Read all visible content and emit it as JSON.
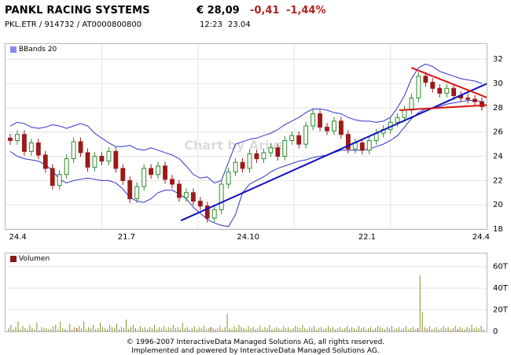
{
  "header": {
    "name": "PANKL RACING SYSTEMS",
    "price": "€ 28,09",
    "change": "-0,41",
    "change_pct": "-1,44%",
    "ids": "PKL.ETR  /  914732  /  AT0000800800",
    "time": "12:23",
    "date": "23.04"
  },
  "colors": {
    "accent_negative": "#b22222",
    "candle_up": "#2e8b2e",
    "candle_down": "#9b1a1a",
    "bollinger": "#3333cc",
    "trend_up": "#1010c0",
    "trend_red": "#dd1111",
    "volume": "#8b8b2b",
    "volume_highlight": "#8b1a1a",
    "grid": "#e4e4e4"
  },
  "watermark": "Chart by Ariva",
  "footer": {
    "line1": "© 1996-2007 InteractiveData Managed Solutions  AG, all rights reserved.",
    "line2": "Implemented and powered by  InteractiveData Managed Solutions  AG."
  },
  "chart_data": [
    {
      "type": "candlestick",
      "legend": "BBands 20",
      "x_ticks": [
        "24.4",
        "21.7",
        "24.10",
        "22.1",
        "24.4"
      ],
      "y_ticks": [
        18,
        20,
        22,
        24,
        26,
        28,
        30,
        32
      ],
      "ylim": [
        18,
        32.6
      ],
      "grid": true,
      "closes": [
        25.3,
        25.8,
        24.4,
        25.1,
        24.1,
        23.0,
        21.6,
        22.5,
        23.8,
        25.2,
        24.3,
        23.1,
        24.0,
        23.6,
        24.4,
        23.0,
        22.0,
        20.5,
        21.5,
        23.0,
        22.5,
        23.2,
        22.1,
        21.7,
        20.6,
        21.0,
        20.3,
        19.9,
        18.9,
        19.6,
        21.7,
        22.7,
        23.5,
        23.0,
        24.2,
        23.8,
        24.3,
        24.7,
        24.0,
        25.3,
        25.7,
        25.0,
        26.5,
        27.5,
        26.4,
        26.1,
        26.9,
        25.8,
        24.6,
        25.1,
        24.5,
        25.3,
        25.9,
        26.2,
        26.8,
        27.2,
        27.8,
        28.8,
        30.6,
        30.1,
        29.6,
        29.2,
        29.6,
        29.0,
        28.8,
        28.7,
        28.5,
        28.1
      ],
      "bband_upper": [
        26.5,
        26.8,
        26.7,
        26.4,
        26.3,
        26.4,
        26.6,
        26.5,
        26.3,
        26.5,
        26.7,
        26.5,
        25.9,
        25.5,
        25.1,
        24.8,
        24.8,
        24.9,
        24.6,
        24.5,
        24.7,
        24.5,
        24.3,
        24.1,
        23.8,
        23.2,
        22.5,
        22.2,
        22.3,
        21.8,
        22.0,
        23.5,
        25.0,
        25.2,
        25.4,
        25.5,
        25.7,
        25.9,
        26.2,
        26.6,
        26.9,
        27.2,
        27.6,
        27.9,
        27.9,
        27.8,
        27.6,
        27.5,
        27.2,
        27.0,
        26.9,
        26.9,
        26.8,
        26.9,
        27.2,
        28.0,
        29.0,
        30.4,
        31.3,
        31.6,
        31.4,
        31.0,
        30.8,
        30.6,
        30.4,
        30.3,
        30.2,
        30.0
      ],
      "bband_lower": [
        24.4,
        24.0,
        23.8,
        23.7,
        23.6,
        23.3,
        22.8,
        22.1,
        21.8,
        22.0,
        22.1,
        22.2,
        22.1,
        22.0,
        22.0,
        21.8,
        21.3,
        20.6,
        20.3,
        20.2,
        20.5,
        21.0,
        21.2,
        21.2,
        20.9,
        20.5,
        19.8,
        19.3,
        18.8,
        18.5,
        18.3,
        18.2,
        19.2,
        21.0,
        21.7,
        22.0,
        22.3,
        22.7,
        23.0,
        23.2,
        23.4,
        23.6,
        23.7,
        23.9,
        24.0,
        24.1,
        24.3,
        24.5,
        24.5,
        24.5,
        24.5,
        24.6,
        24.8,
        25.0,
        25.3,
        25.7,
        26.4,
        27.1,
        27.6,
        27.9,
        28.0,
        28.1,
        28.3,
        28.4,
        28.5,
        28.6,
        28.6,
        28.5
      ],
      "trendlines": [
        {
          "color": "trend_up",
          "from": {
            "x": 0.3646,
            "y": 18.7
          },
          "to": {
            "x": 1.035,
            "y": 30.6
          }
        },
        {
          "color": "trend_red",
          "from": {
            "x": 0.8436,
            "y": 31.3
          },
          "to": {
            "x": 1.035,
            "y": 28.3
          }
        },
        {
          "color": "trend_red",
          "from": {
            "x": 0.8183,
            "y": 27.8
          },
          "to": {
            "x": 1.035,
            "y": 28.3
          }
        }
      ]
    },
    {
      "type": "bar",
      "legend": "Volumen",
      "y_ticks": [
        "0",
        "20T",
        "40T",
        "60T"
      ],
      "ylim": [
        0,
        62
      ],
      "grid": true,
      "values": [
        3,
        6,
        2,
        4,
        9,
        2,
        5,
        3,
        2,
        6,
        3,
        2,
        8,
        1,
        4,
        3,
        3,
        2,
        2,
        5,
        6,
        2,
        9,
        3,
        2,
        1,
        7,
        2,
        4,
        3,
        5,
        3,
        9,
        2,
        4,
        3,
        6,
        2,
        3,
        8,
        4,
        3,
        2,
        6,
        4,
        3,
        7,
        2,
        4,
        3,
        11,
        2,
        4,
        6,
        3,
        2,
        5,
        3,
        4,
        2,
        4,
        3,
        6,
        2,
        4,
        3,
        5,
        2,
        4,
        3,
        6,
        3,
        4,
        2,
        8,
        3,
        4,
        2,
        3,
        5,
        2,
        4,
        3,
        5,
        2,
        3,
        4,
        3,
        2,
        3,
        5,
        2,
        4,
        16,
        3,
        2,
        5,
        3,
        6,
        4,
        3,
        2,
        5,
        3,
        4,
        2,
        3,
        5,
        2,
        4,
        3,
        6,
        2,
        3,
        4,
        3,
        2,
        5,
        3,
        4,
        2,
        3,
        5,
        4,
        3,
        6,
        3,
        2,
        4,
        3,
        5,
        2,
        3,
        4,
        2,
        3,
        5,
        3,
        4,
        2,
        3,
        4,
        2,
        3,
        5,
        2,
        4,
        3,
        2,
        5,
        3,
        4,
        2,
        3,
        4,
        2,
        3,
        5,
        4,
        3,
        2,
        4,
        3,
        5,
        2,
        3,
        4,
        2,
        3,
        5,
        2,
        3,
        4,
        2,
        3,
        52,
        18,
        4,
        3,
        5,
        2,
        3,
        4,
        2,
        3,
        5,
        3,
        4,
        2,
        3,
        5,
        2,
        4,
        3,
        2,
        4,
        3,
        6,
        3,
        4,
        3,
        5,
        2
      ],
      "highlight_indices": [
        29,
        86,
        174,
        191
      ]
    }
  ]
}
